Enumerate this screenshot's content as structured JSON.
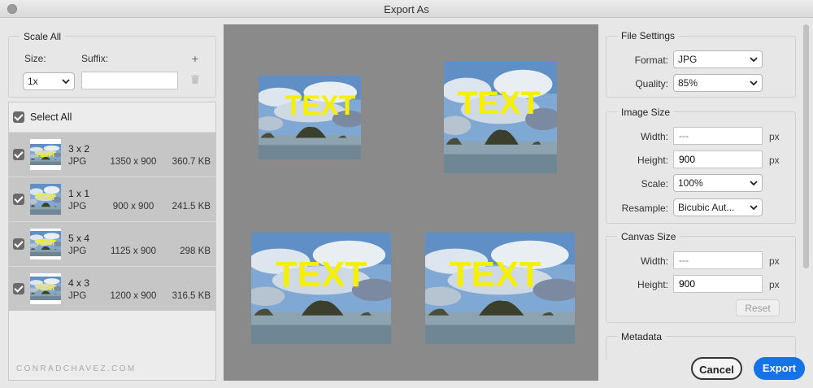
{
  "window": {
    "title": "Export As"
  },
  "scale_all": {
    "legend": "Scale All",
    "size_label": "Size:",
    "suffix_label": "Suffix:",
    "add_icon": "+",
    "size_value": "1x",
    "suffix_value": ""
  },
  "asset_list": {
    "select_all_label": "Select All",
    "items": [
      {
        "name": "3 x 2",
        "format": "JPG",
        "dimensions": "1350 x 900",
        "size": "360.7 KB"
      },
      {
        "name": "1 x 1",
        "format": "JPG",
        "dimensions": "900 x 900",
        "size": "241.5 KB"
      },
      {
        "name": "5 x 4",
        "format": "JPG",
        "dimensions": "1125 x 900",
        "size": "298 KB"
      },
      {
        "name": "4 x 3",
        "format": "JPG",
        "dimensions": "1200 x 900",
        "size": "316.5 KB"
      }
    ]
  },
  "preview": {
    "overlay_text": "TEXT"
  },
  "watermark": "CONRADCHAVEZ.COM",
  "file_settings": {
    "legend": "File Settings",
    "format_label": "Format:",
    "format_value": "JPG",
    "quality_label": "Quality:",
    "quality_value": "85%"
  },
  "image_size": {
    "legend": "Image Size",
    "width_label": "Width:",
    "width_placeholder": "---",
    "height_label": "Height:",
    "height_value": "900",
    "unit": "px",
    "scale_label": "Scale:",
    "scale_value": "100%",
    "resample_label": "Resample:",
    "resample_value": "Bicubic Aut..."
  },
  "canvas_size": {
    "legend": "Canvas Size",
    "width_label": "Width:",
    "width_placeholder": "---",
    "height_label": "Height:",
    "height_value": "900",
    "unit": "px",
    "reset_label": "Reset"
  },
  "metadata": {
    "legend": "Metadata"
  },
  "actions": {
    "cancel_label": "Cancel",
    "export_label": "Export"
  },
  "colors": {
    "accent": "#1473e6",
    "overlay_text": "#f5f000",
    "preview_bg": "#8a8a8a"
  }
}
